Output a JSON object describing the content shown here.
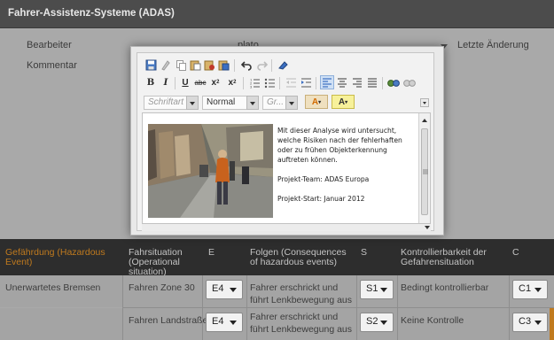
{
  "window": {
    "title": "Fahrer-Assistenz-Systeme (ADAS)"
  },
  "form": {
    "bearbeiter_label": "Bearbeiter",
    "bearbeiter_value": "plato",
    "letzte_aenderung_label": "Letzte Änderung",
    "kommentar_label": "Kommentar"
  },
  "editor": {
    "font_placeholder": "Schriftart",
    "format_value": "Normal",
    "size_placeholder": "Gr...",
    "content": {
      "paragraph1": "Mit dieser Analyse wird untersucht, welche Risiken nach der fehlerhaften oder zu frühen Objekterkennung auftreten können.",
      "paragraph2": "Projekt-Team: ADAS Europa",
      "paragraph3": "Projekt-Start: Januar 2012"
    }
  },
  "table": {
    "headers": [
      "Gefährdung (Hazardous Event)",
      "Fahrsituation (Operational situation)",
      "E",
      "Folgen (Consequences of hazardous events)",
      "S",
      "Kontrollierbarkeit der Gefahrensituation",
      "C"
    ],
    "rows": [
      {
        "hazard": "Unerwartetes Bremsen",
        "situation": "Fahren Zone 30",
        "e": "E4",
        "consequence": "Fahrer erschrickt und führt Lenkbewegung aus",
        "s": "S1",
        "control": "Bedingt kontrollierbar",
        "c": "C1"
      },
      {
        "hazard": "",
        "situation": "Fahren Landstraße",
        "e": "E4",
        "consequence": "Fahrer erschrickt und führt Lenkbewegung aus",
        "s": "S2",
        "control": "Keine Kontrolle",
        "c": "C3"
      }
    ]
  },
  "colors": {
    "header_bg": "#4c4c4c",
    "accent_orange": "#c07a1e",
    "table_header_bg": "#2d2d2d"
  }
}
